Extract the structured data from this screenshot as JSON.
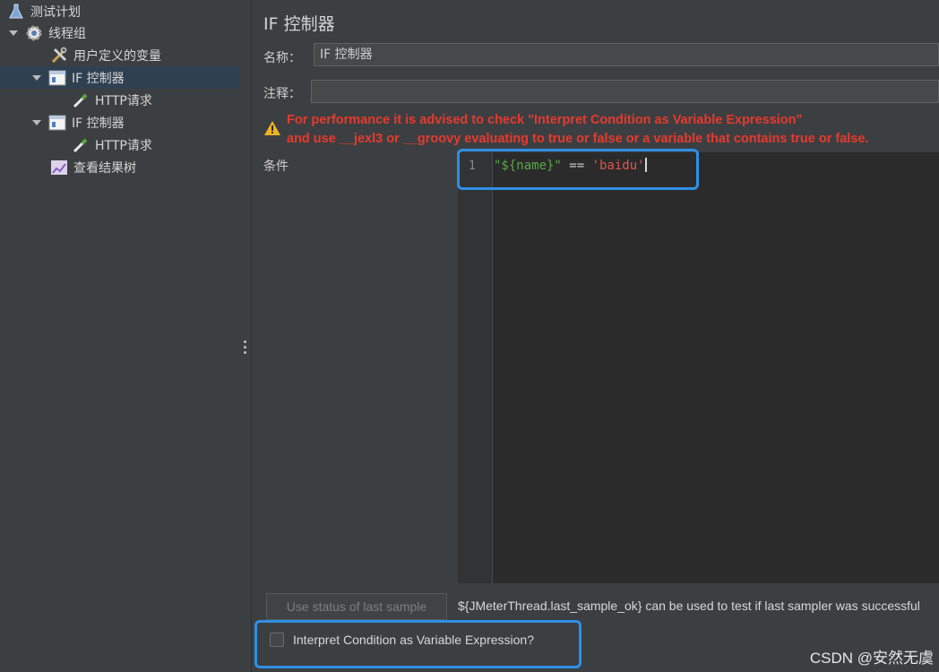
{
  "tree": {
    "items": [
      {
        "label": "测试计划",
        "icon": "flask-icon"
      },
      {
        "label": "线程组",
        "icon": "gear-icon"
      },
      {
        "label": "用户定义的变量",
        "icon": "tools-icon"
      },
      {
        "label": "IF 控制器",
        "icon": "controller-icon"
      },
      {
        "label": "HTTP请求",
        "icon": "pipette-icon"
      },
      {
        "label": "IF 控制器",
        "icon": "controller-icon"
      },
      {
        "label": "HTTP请求",
        "icon": "pipette-icon"
      },
      {
        "label": "查看结果树",
        "icon": "chart-icon"
      }
    ]
  },
  "panel": {
    "title": "IF 控制器",
    "name_label": "名称：",
    "name_value": "IF 控制器",
    "comment_label": "注释：",
    "comment_value": "",
    "warning_line1": "For performance it is advised to check \"Interpret Condition as Variable Expression\"",
    "warning_line2": "and use __jexl3 or __groovy evaluating to true or false or a variable that contains true or false.",
    "condition_label": "条件",
    "editor": {
      "line_number": "1",
      "code_part1": "\"${name}\"",
      "code_part2": " == ",
      "code_part3": "'baidu'"
    },
    "use_status_button": "Use status of last sample",
    "help_text": "${JMeterThread.last_sample_ok} can be used to test if last sampler was successful",
    "interpret_checkbox_label": "Interpret Condition as Variable Expression?",
    "interpret_checked": false
  },
  "colors": {
    "warning_text": "#e7392e",
    "highlight_box": "#2f8fe6",
    "code_string_green": "#58a847",
    "code_string_red": "#e0554b"
  },
  "watermark": "CSDN @安然无虞"
}
